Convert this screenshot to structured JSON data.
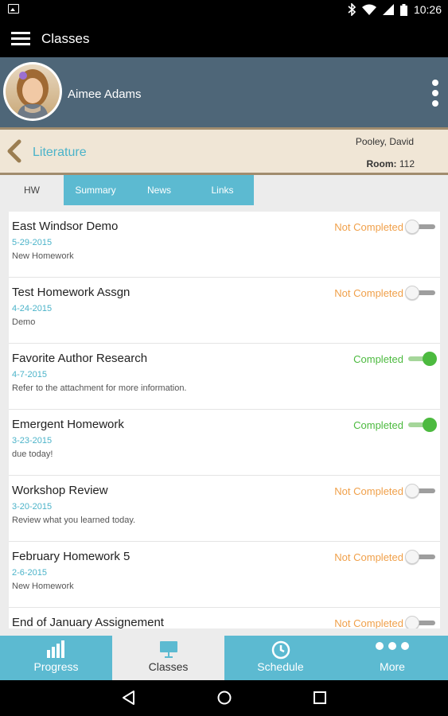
{
  "status_bar": {
    "time": "10:26"
  },
  "app_bar": {
    "title": "Classes"
  },
  "profile": {
    "name": "Aimee Adams"
  },
  "class_info": {
    "name": "Literature",
    "teacher": "Pooley, David",
    "room_label": "Room:",
    "room_value": "112"
  },
  "tabs": [
    {
      "label": "HW",
      "active": true
    },
    {
      "label": "Summary"
    },
    {
      "label": "News"
    },
    {
      "label": "Links"
    }
  ],
  "colors": {
    "completed": "#4cba3f",
    "not_completed": "#f0a04a",
    "accent": "#5cbad1",
    "link": "#4bb3c9"
  },
  "homework": [
    {
      "title": "East Windsor Demo",
      "date": "5-29-2015",
      "note": "New Homework",
      "status": "Not Completed",
      "done": false
    },
    {
      "title": "Test Homework Assgn",
      "date": "4-24-2015",
      "note": "Demo",
      "status": "Not Completed",
      "done": false
    },
    {
      "title": "Favorite Author Research",
      "date": "4-7-2015",
      "note": "Refer to the attachment for more information.",
      "status": "Completed",
      "done": true
    },
    {
      "title": "Emergent Homework",
      "date": "3-23-2015",
      "note": "due today!",
      "status": "Completed",
      "done": true
    },
    {
      "title": "Workshop Review",
      "date": "3-20-2015",
      "note": "Review what you learned today.",
      "status": "Not Completed",
      "done": false
    },
    {
      "title": "February Homework 5",
      "date": "2-6-2015",
      "note": "New Homework",
      "status": "Not Completed",
      "done": false
    },
    {
      "title": "End of January Assignement",
      "date": "",
      "note": "",
      "status": "Not Completed",
      "done": false
    }
  ],
  "bottom_nav": [
    {
      "label": "Progress",
      "icon": "progress-icon"
    },
    {
      "label": "Classes",
      "icon": "classes-icon",
      "active": true
    },
    {
      "label": "Schedule",
      "icon": "schedule-icon"
    },
    {
      "label": "More",
      "icon": "more-icon"
    }
  ]
}
